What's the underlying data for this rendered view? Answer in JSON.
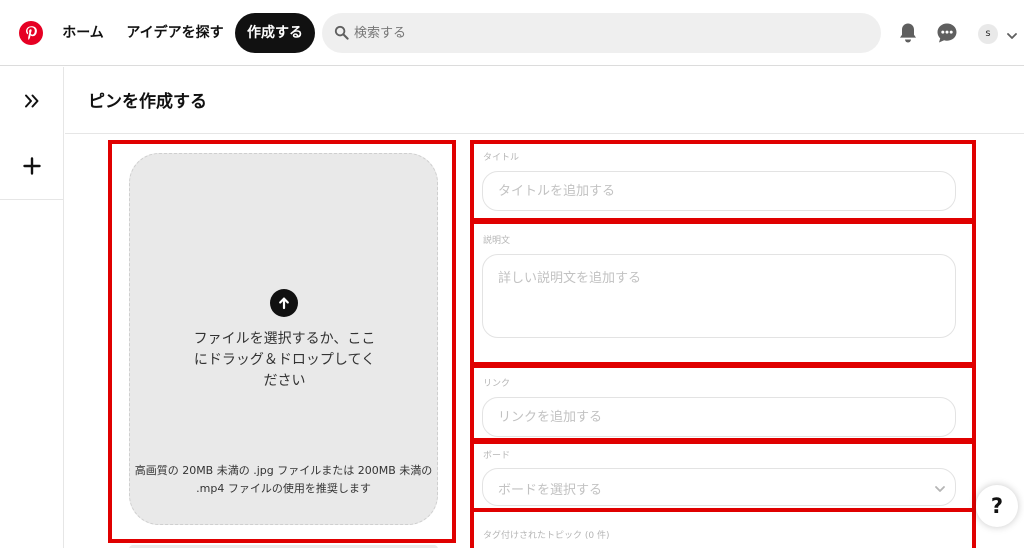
{
  "colors": {
    "brand": "#e60023",
    "annotation": "#e00000",
    "dark_button": "#111111",
    "upload_bg": "#e9e9e9"
  },
  "topbar": {
    "logo_icon": "pinterest-logo",
    "nav": {
      "home": "ホーム",
      "explore": "アイデアを探す",
      "create": "作成する"
    },
    "search": {
      "placeholder": "検索する",
      "icon": "search-icon"
    },
    "notifications_icon": "bell-icon",
    "messages_icon": "chat-icon",
    "avatar_initial": "s",
    "account_icon": "chevron-down-icon"
  },
  "rail": {
    "expand_icon": "double-chevron-right-icon",
    "add_icon": "plus-icon"
  },
  "page": {
    "title": "ピンを作成する"
  },
  "upload": {
    "icon": "upload-arrow-icon",
    "main_text": "ファイルを選択するか、ここにドラッグ＆ドロップしてください",
    "hint_text": "高画質の 20MB 未満の .jpg ファイルまたは 200MB 未満の .mp4 ファイルの使用を推奨します"
  },
  "form": {
    "title": {
      "label": "タイトル",
      "placeholder": "タイトルを追加する"
    },
    "description": {
      "label": "説明文",
      "placeholder": "詳しい説明文を追加する"
    },
    "link": {
      "label": "リンク",
      "placeholder": "リンクを追加する"
    },
    "board": {
      "label": "ボード",
      "value": "ボードを選択する"
    },
    "tags": {
      "label": "タグ付けされたトピック (0 件)"
    }
  },
  "help": {
    "label": "?"
  }
}
